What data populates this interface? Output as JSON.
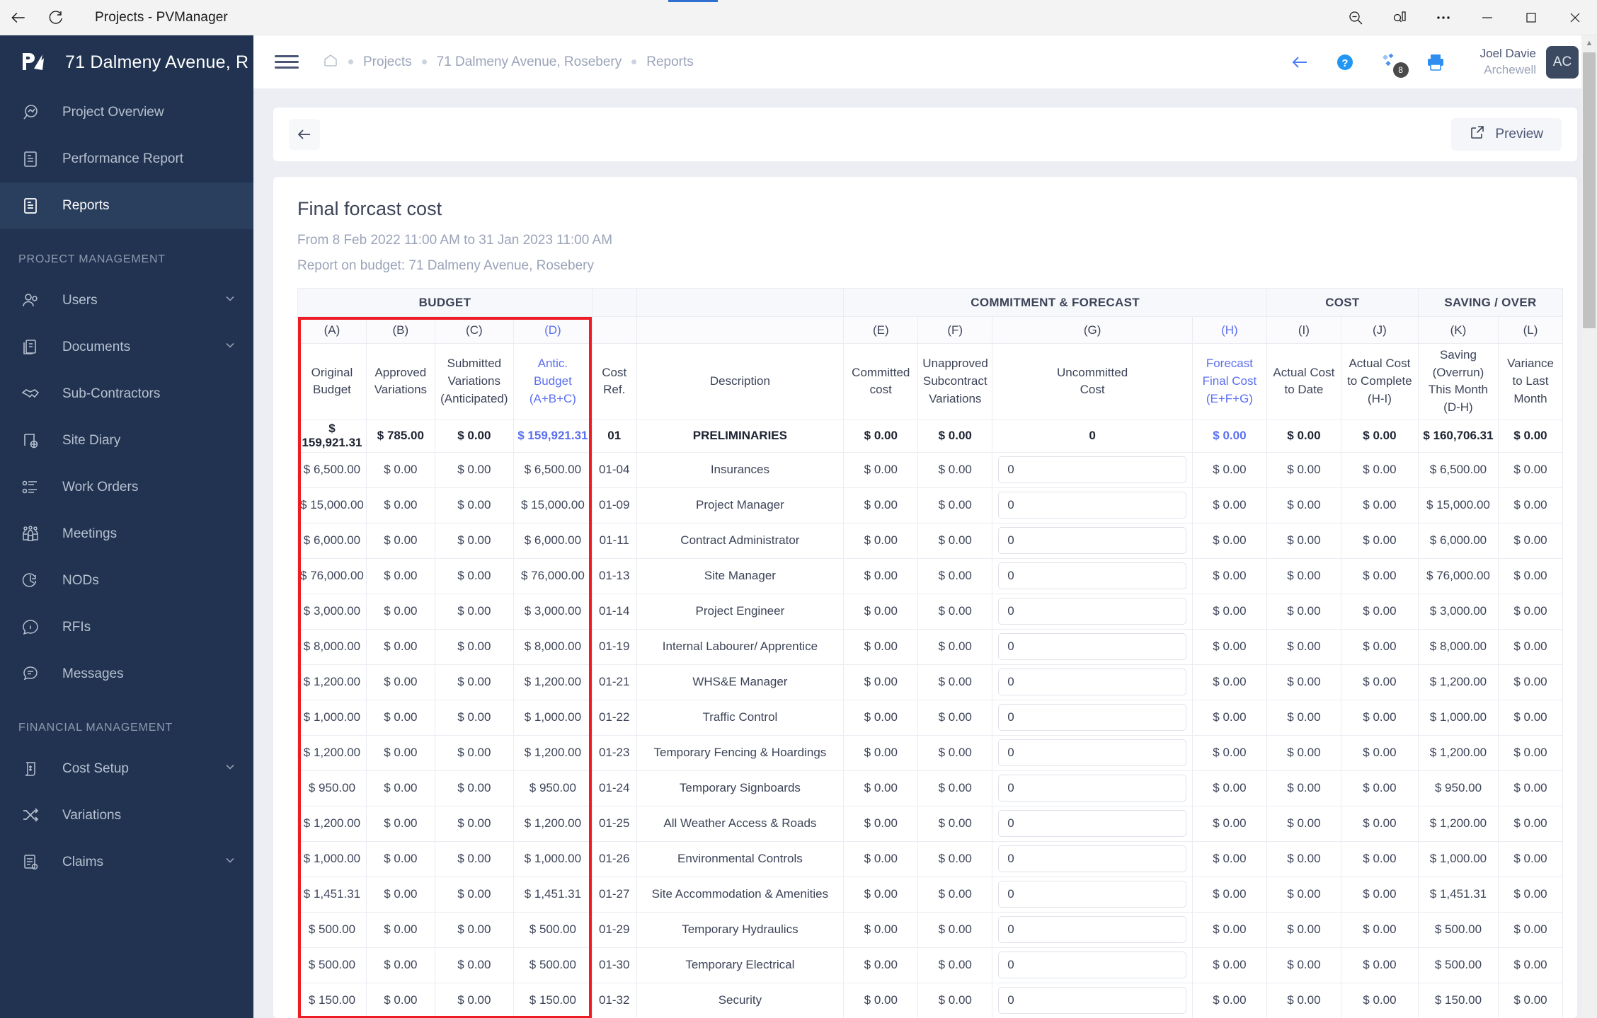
{
  "window": {
    "title": "Projects - PVManager",
    "back_label": "back-arrow",
    "refresh_label": "refresh",
    "zoom_out": "zoom-out",
    "reading": "reading-view",
    "more": "...",
    "minimize": "minimize",
    "maximize": "maximize",
    "close": "close"
  },
  "sidebar": {
    "project_name": "71 Dalmeny Avenue, R",
    "items": [
      {
        "label": "Project Overview",
        "icon": "project-overview-icon",
        "active": false,
        "caret": false
      },
      {
        "label": "Performance Report",
        "icon": "performance-report-icon",
        "active": false,
        "caret": false
      },
      {
        "label": "Reports",
        "icon": "reports-icon",
        "active": true,
        "caret": false
      }
    ],
    "sections": [
      {
        "title": "PROJECT MANAGEMENT",
        "items": [
          {
            "label": "Users",
            "icon": "users-icon",
            "caret": true
          },
          {
            "label": "Documents",
            "icon": "documents-icon",
            "caret": true
          },
          {
            "label": "Sub-Contractors",
            "icon": "handshake-icon",
            "caret": false
          },
          {
            "label": "Site Diary",
            "icon": "site-diary-icon",
            "caret": false
          },
          {
            "label": "Work Orders",
            "icon": "work-orders-icon",
            "caret": false
          },
          {
            "label": "Meetings",
            "icon": "meetings-icon",
            "caret": false
          },
          {
            "label": "NODs",
            "icon": "nods-icon",
            "caret": false
          },
          {
            "label": "RFIs",
            "icon": "rfis-icon",
            "caret": false
          },
          {
            "label": "Messages",
            "icon": "messages-icon",
            "caret": false
          }
        ]
      },
      {
        "title": "FINANCIAL MANAGEMENT",
        "items": [
          {
            "label": "Cost Setup",
            "icon": "cost-setup-icon",
            "caret": true
          },
          {
            "label": "Variations",
            "icon": "variations-icon",
            "caret": false
          },
          {
            "label": "Claims",
            "icon": "claims-icon",
            "caret": true
          }
        ]
      }
    ]
  },
  "topbar": {
    "breadcrumbs": [
      "Projects",
      "71 Dalmeny Avenue, Rosebery",
      "Reports"
    ],
    "home_icon": "home-icon",
    "actions": [
      {
        "icon": "back-arrow-icon",
        "badge": ""
      },
      {
        "icon": "help-icon",
        "badge": ""
      },
      {
        "icon": "apps-icon",
        "badge": "8"
      },
      {
        "icon": "print-icon",
        "badge": ""
      }
    ],
    "user": {
      "name": "Joel Davie",
      "org": "Archewell",
      "initials": "AC"
    }
  },
  "toolbar": {
    "back_icon": "arrow-left-icon",
    "preview_label": "Preview",
    "preview_icon": "external-link-icon"
  },
  "report": {
    "title": "Final forcast cost",
    "date_range": "From 8 Feb 2022 11:00 AM to 31 Jan 2023 11:00 AM",
    "budget_line": "Report on budget: 71 Dalmeny Avenue, Rosebery"
  },
  "highlight_color": "#ee1c24",
  "accent_color": "#5b6ff0",
  "table": {
    "groups": [
      {
        "label": "BUDGET",
        "span": 4
      },
      {
        "label": "",
        "span": 1
      },
      {
        "label": "",
        "span": 1
      },
      {
        "label": "COMMITMENT & FORECAST",
        "span": 4
      },
      {
        "label": "COST",
        "span": 2
      },
      {
        "label": "SAVING / OVER",
        "span": 2
      }
    ],
    "letters": [
      "(A)",
      "(B)",
      "(C)",
      "(D)",
      "",
      "",
      "(E)",
      "(F)",
      "(G)",
      "(H)",
      "(I)",
      "(J)",
      "(K)",
      "(L)"
    ],
    "letters_blue": [
      false,
      false,
      false,
      true,
      false,
      false,
      false,
      false,
      false,
      true,
      false,
      false,
      false,
      false
    ],
    "headers": [
      "Original Budget",
      "Approved Variations",
      "Submitted Variations (Anticipated)",
      "Antic. Budget (A+B+C)",
      "Cost Ref.",
      "Description",
      "Committed cost",
      "Unapproved Subcontract Variations",
      "Uncommitted Cost",
      "Forecast Final Cost (E+F+G)",
      "Actual Cost to Date",
      "Actual Cost to Complete (H-I)",
      "Saving (Overrun) This Month (D-H)",
      "Variance to Last Month"
    ],
    "headers_lines": [
      [
        "Original",
        "Budget"
      ],
      [
        "Approved",
        "Variations"
      ],
      [
        "Submitted",
        "Variations",
        "(Anticipated)"
      ],
      [
        "Antic.",
        "Budget",
        "(A+B+C)"
      ],
      [
        "Cost",
        "Ref."
      ],
      [
        "Description"
      ],
      [
        "Committed",
        "cost"
      ],
      [
        "Unapproved",
        "Subcontract",
        "Variations"
      ],
      [
        "Uncommitted",
        "Cost"
      ],
      [
        "Forecast",
        "Final Cost",
        "(E+F+G)"
      ],
      [
        "Actual Cost",
        "to Date"
      ],
      [
        "Actual Cost",
        "to Complete",
        "(H-I)"
      ],
      [
        "Saving",
        "(Overrun)",
        "This Month",
        "(D-H)"
      ],
      [
        "Variance",
        "to Last",
        "Month"
      ]
    ],
    "headers_blue": [
      false,
      false,
      false,
      true,
      false,
      false,
      false,
      false,
      false,
      true,
      false,
      false,
      false,
      false
    ],
    "rows": [
      {
        "total": true,
        "a": "$ 159,921.31",
        "b": "$ 785.00",
        "c": "$ 0.00",
        "d": "$ 159,921.31",
        "ref": "01",
        "desc": "PRELIMINARIES",
        "e": "$ 0.00",
        "f": "$ 0.00",
        "g": "0",
        "g_input": false,
        "h": "$ 0.00",
        "i": "$ 0.00",
        "j": "$ 0.00",
        "k": "$ 160,706.31",
        "l": "$ 0.00"
      },
      {
        "total": false,
        "a": "$ 6,500.00",
        "b": "$ 0.00",
        "c": "$ 0.00",
        "d": "$ 6,500.00",
        "ref": "01-04",
        "desc": "Insurances",
        "e": "$ 0.00",
        "f": "$ 0.00",
        "g": "0",
        "g_input": true,
        "h": "$ 0.00",
        "i": "$ 0.00",
        "j": "$ 0.00",
        "k": "$ 6,500.00",
        "l": "$ 0.00"
      },
      {
        "total": false,
        "a": "$ 15,000.00",
        "b": "$ 0.00",
        "c": "$ 0.00",
        "d": "$ 15,000.00",
        "ref": "01-09",
        "desc": "Project Manager",
        "e": "$ 0.00",
        "f": "$ 0.00",
        "g": "0",
        "g_input": true,
        "h": "$ 0.00",
        "i": "$ 0.00",
        "j": "$ 0.00",
        "k": "$ 15,000.00",
        "l": "$ 0.00"
      },
      {
        "total": false,
        "a": "$ 6,000.00",
        "b": "$ 0.00",
        "c": "$ 0.00",
        "d": "$ 6,000.00",
        "ref": "01-11",
        "desc": "Contract Administrator",
        "e": "$ 0.00",
        "f": "$ 0.00",
        "g": "0",
        "g_input": true,
        "h": "$ 0.00",
        "i": "$ 0.00",
        "j": "$ 0.00",
        "k": "$ 6,000.00",
        "l": "$ 0.00"
      },
      {
        "total": false,
        "a": "$ 76,000.00",
        "b": "$ 0.00",
        "c": "$ 0.00",
        "d": "$ 76,000.00",
        "ref": "01-13",
        "desc": "Site Manager",
        "e": "$ 0.00",
        "f": "$ 0.00",
        "g": "0",
        "g_input": true,
        "h": "$ 0.00",
        "i": "$ 0.00",
        "j": "$ 0.00",
        "k": "$ 76,000.00",
        "l": "$ 0.00"
      },
      {
        "total": false,
        "a": "$ 3,000.00",
        "b": "$ 0.00",
        "c": "$ 0.00",
        "d": "$ 3,000.00",
        "ref": "01-14",
        "desc": "Project Engineer",
        "e": "$ 0.00",
        "f": "$ 0.00",
        "g": "0",
        "g_input": true,
        "h": "$ 0.00",
        "i": "$ 0.00",
        "j": "$ 0.00",
        "k": "$ 3,000.00",
        "l": "$ 0.00"
      },
      {
        "total": false,
        "a": "$ 8,000.00",
        "b": "$ 0.00",
        "c": "$ 0.00",
        "d": "$ 8,000.00",
        "ref": "01-19",
        "desc": "Internal Labourer/ Apprentice",
        "e": "$ 0.00",
        "f": "$ 0.00",
        "g": "0",
        "g_input": true,
        "h": "$ 0.00",
        "i": "$ 0.00",
        "j": "$ 0.00",
        "k": "$ 8,000.00",
        "l": "$ 0.00"
      },
      {
        "total": false,
        "a": "$ 1,200.00",
        "b": "$ 0.00",
        "c": "$ 0.00",
        "d": "$ 1,200.00",
        "ref": "01-21",
        "desc": "WHS&E Manager",
        "e": "$ 0.00",
        "f": "$ 0.00",
        "g": "0",
        "g_input": true,
        "h": "$ 0.00",
        "i": "$ 0.00",
        "j": "$ 0.00",
        "k": "$ 1,200.00",
        "l": "$ 0.00"
      },
      {
        "total": false,
        "a": "$ 1,000.00",
        "b": "$ 0.00",
        "c": "$ 0.00",
        "d": "$ 1,000.00",
        "ref": "01-22",
        "desc": "Traffic Control",
        "e": "$ 0.00",
        "f": "$ 0.00",
        "g": "0",
        "g_input": true,
        "h": "$ 0.00",
        "i": "$ 0.00",
        "j": "$ 0.00",
        "k": "$ 1,000.00",
        "l": "$ 0.00"
      },
      {
        "total": false,
        "a": "$ 1,200.00",
        "b": "$ 0.00",
        "c": "$ 0.00",
        "d": "$ 1,200.00",
        "ref": "01-23",
        "desc": "Temporary Fencing & Hoardings",
        "e": "$ 0.00",
        "f": "$ 0.00",
        "g": "0",
        "g_input": true,
        "h": "$ 0.00",
        "i": "$ 0.00",
        "j": "$ 0.00",
        "k": "$ 1,200.00",
        "l": "$ 0.00"
      },
      {
        "total": false,
        "a": "$ 950.00",
        "b": "$ 0.00",
        "c": "$ 0.00",
        "d": "$ 950.00",
        "ref": "01-24",
        "desc": "Temporary Signboards",
        "e": "$ 0.00",
        "f": "$ 0.00",
        "g": "0",
        "g_input": true,
        "h": "$ 0.00",
        "i": "$ 0.00",
        "j": "$ 0.00",
        "k": "$ 950.00",
        "l": "$ 0.00"
      },
      {
        "total": false,
        "a": "$ 1,200.00",
        "b": "$ 0.00",
        "c": "$ 0.00",
        "d": "$ 1,200.00",
        "ref": "01-25",
        "desc": "All Weather Access & Roads",
        "e": "$ 0.00",
        "f": "$ 0.00",
        "g": "0",
        "g_input": true,
        "h": "$ 0.00",
        "i": "$ 0.00",
        "j": "$ 0.00",
        "k": "$ 1,200.00",
        "l": "$ 0.00"
      },
      {
        "total": false,
        "a": "$ 1,000.00",
        "b": "$ 0.00",
        "c": "$ 0.00",
        "d": "$ 1,000.00",
        "ref": "01-26",
        "desc": "Environmental Controls",
        "e": "$ 0.00",
        "f": "$ 0.00",
        "g": "0",
        "g_input": true,
        "h": "$ 0.00",
        "i": "$ 0.00",
        "j": "$ 0.00",
        "k": "$ 1,000.00",
        "l": "$ 0.00"
      },
      {
        "total": false,
        "a": "$ 1,451.31",
        "b": "$ 0.00",
        "c": "$ 0.00",
        "d": "$ 1,451.31",
        "ref": "01-27",
        "desc": "Site Accommodation & Amenities",
        "e": "$ 0.00",
        "f": "$ 0.00",
        "g": "0",
        "g_input": true,
        "h": "$ 0.00",
        "i": "$ 0.00",
        "j": "$ 0.00",
        "k": "$ 1,451.31",
        "l": "$ 0.00"
      },
      {
        "total": false,
        "a": "$ 500.00",
        "b": "$ 0.00",
        "c": "$ 0.00",
        "d": "$ 500.00",
        "ref": "01-29",
        "desc": "Temporary Hydraulics",
        "e": "$ 0.00",
        "f": "$ 0.00",
        "g": "0",
        "g_input": true,
        "h": "$ 0.00",
        "i": "$ 0.00",
        "j": "$ 0.00",
        "k": "$ 500.00",
        "l": "$ 0.00"
      },
      {
        "total": false,
        "a": "$ 500.00",
        "b": "$ 0.00",
        "c": "$ 0.00",
        "d": "$ 500.00",
        "ref": "01-30",
        "desc": "Temporary Electrical",
        "e": "$ 0.00",
        "f": "$ 0.00",
        "g": "0",
        "g_input": true,
        "h": "$ 0.00",
        "i": "$ 0.00",
        "j": "$ 0.00",
        "k": "$ 500.00",
        "l": "$ 0.00"
      },
      {
        "total": false,
        "a": "$ 150.00",
        "b": "$ 0.00",
        "c": "$ 0.00",
        "d": "$ 150.00",
        "ref": "01-32",
        "desc": "Security",
        "e": "$ 0.00",
        "f": "$ 0.00",
        "g": "0",
        "g_input": true,
        "h": "$ 0.00",
        "i": "$ 0.00",
        "j": "$ 0.00",
        "k": "$ 150.00",
        "l": "$ 0.00"
      }
    ]
  }
}
